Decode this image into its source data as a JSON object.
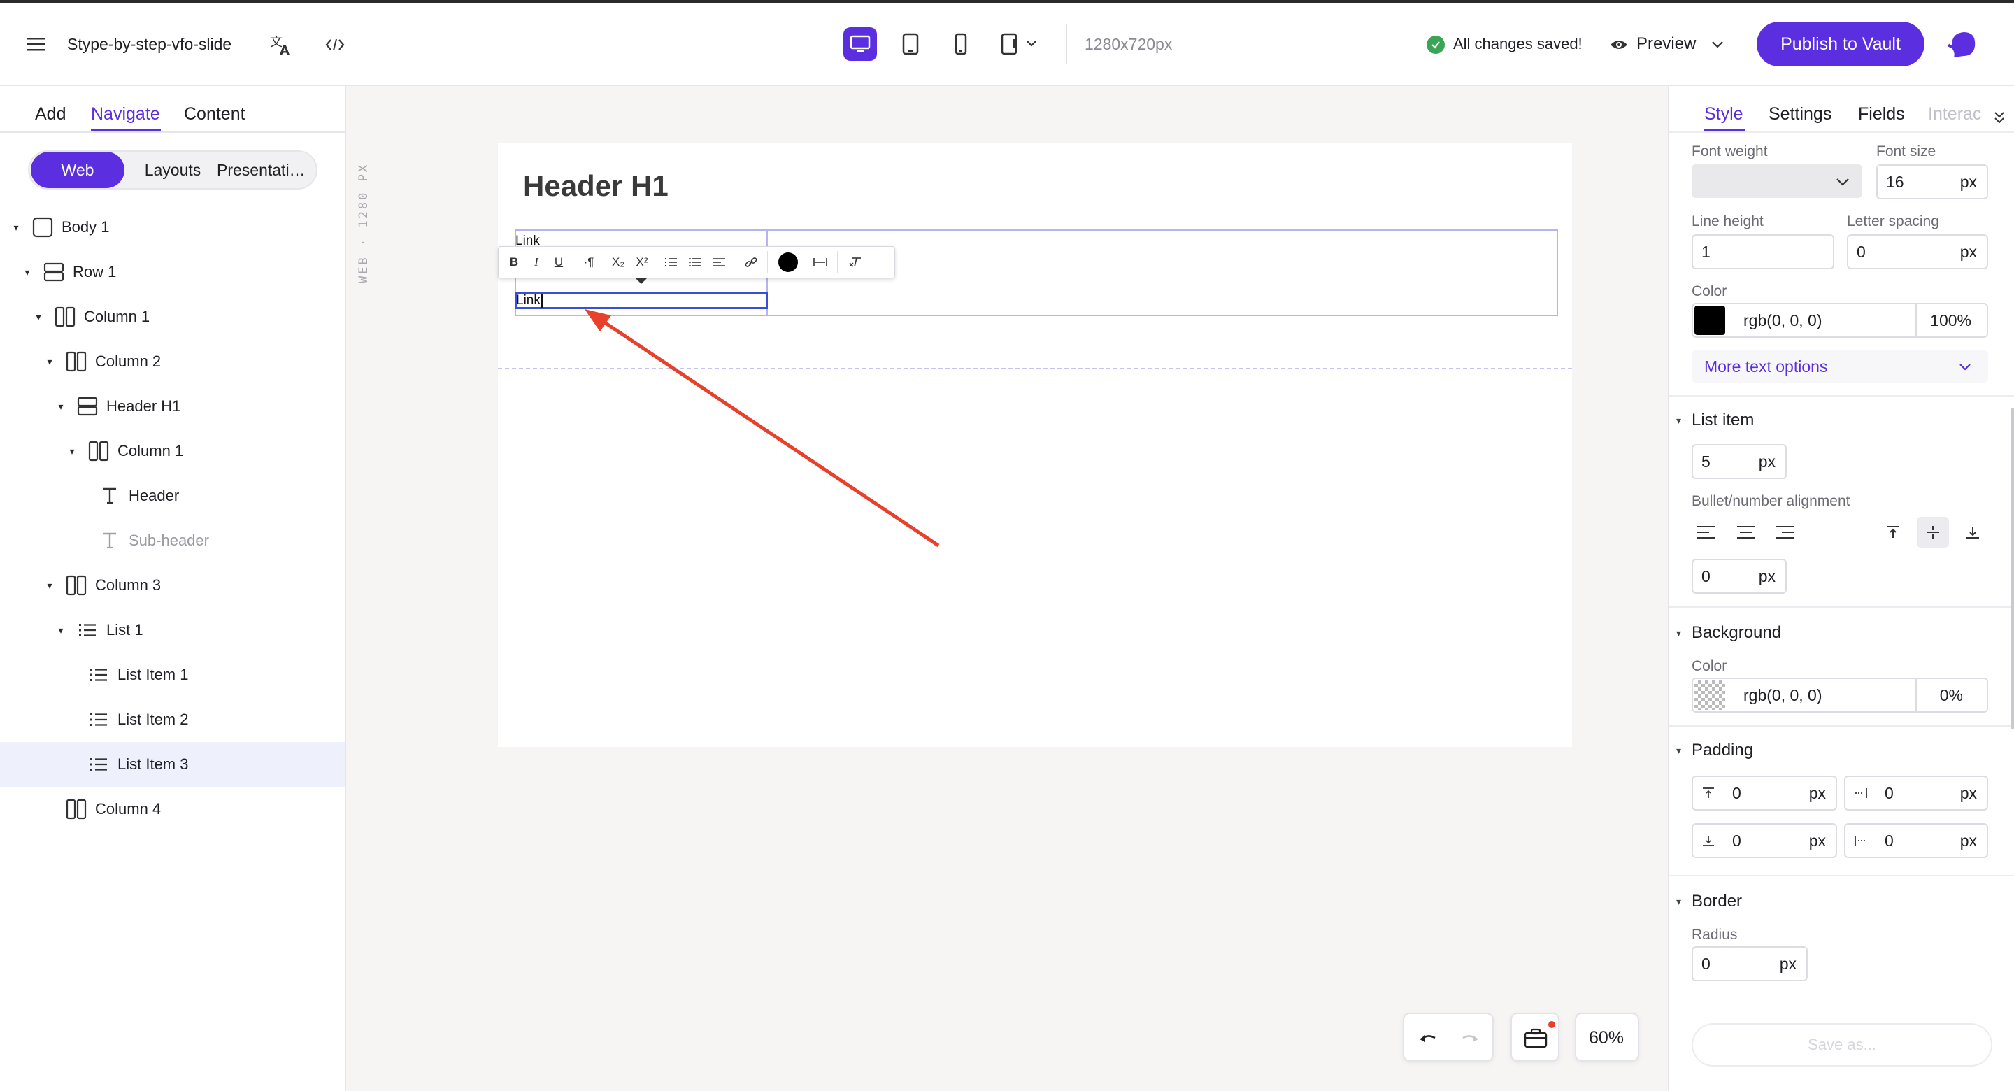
{
  "app": {
    "doc_title": "Stype-by-step-vfo-slide",
    "resolution": "1280x720px",
    "status": "All changes saved!",
    "preview_label": "Preview",
    "publish_label": "Publish to Vault"
  },
  "colors": {
    "accent": "#5b2ee0",
    "arrow": "#e8402a",
    "status_ok": "#3aa655"
  },
  "left_panel": {
    "tabs": [
      "Add",
      "Navigate",
      "Content"
    ],
    "active_tab": "Navigate",
    "segments": [
      "Web",
      "Layouts",
      "Presentati…"
    ],
    "active_segment": "Web",
    "tree": [
      {
        "label": "Body 1",
        "icon": "body-icon"
      },
      {
        "label": "Row 1",
        "icon": "row-icon"
      },
      {
        "label": "Column 1",
        "icon": "column-icon"
      },
      {
        "label": "Column 2",
        "icon": "column-icon"
      },
      {
        "label": "Header H1",
        "icon": "row-icon"
      },
      {
        "label": "Column 1",
        "icon": "column-icon"
      },
      {
        "label": "Header",
        "icon": "text-icon"
      },
      {
        "label": "Sub-header",
        "icon": "text-icon",
        "hidden": true
      },
      {
        "label": "Column 3",
        "icon": "column-icon"
      },
      {
        "label": "List 1",
        "icon": "list-icon"
      },
      {
        "label": "List Item 1",
        "icon": "list-icon"
      },
      {
        "label": "List Item 2",
        "icon": "list-icon"
      },
      {
        "label": "List Item 3",
        "icon": "list-icon",
        "selected": true
      },
      {
        "label": "Column 4",
        "icon": "column-icon"
      }
    ]
  },
  "canvas": {
    "ruler_label": "WEB · 1280 PX",
    "slide_header": "Header H1",
    "link_top": "Link",
    "link_selected": "Link",
    "zoom": "60%"
  },
  "right_panel": {
    "tabs": [
      "Style",
      "Settings",
      "Fields",
      "Interac"
    ],
    "active_tab": "Style",
    "font_weight_label": "Font weight",
    "font_weight_value": "",
    "font_size_label": "Font size",
    "font_size_value": "16",
    "line_height_label": "Line height",
    "line_height_value": "1",
    "letter_spacing_label": "Letter spacing",
    "letter_spacing_value": "0",
    "color_label": "Color",
    "color_value": "rgb(0, 0, 0)",
    "color_opacity": "100%",
    "more_text_options": "More text options",
    "list_item_title": "List item",
    "list_item_spacing": "5",
    "bullet_alignment_label": "Bullet/number alignment",
    "bullet_offset": "0",
    "background_title": "Background",
    "background_color_label": "Color",
    "background_color_value": "rgb(0, 0, 0)",
    "background_opacity": "0%",
    "padding_title": "Padding",
    "padding_top": "0",
    "padding_right": "0",
    "padding_bottom": "0",
    "padding_left": "0",
    "border_title": "Border",
    "radius_label": "Radius",
    "radius_value": "0",
    "unit": "px",
    "save_as_label": "Save as..."
  }
}
